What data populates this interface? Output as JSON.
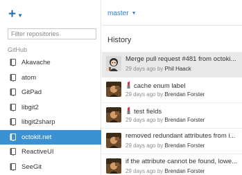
{
  "sidebar": {
    "add_icon": "plus-icon",
    "filter_placeholder": "Filter repositories",
    "group_label": "GitHub",
    "repos": [
      {
        "name": "Akavache",
        "selected": false
      },
      {
        "name": "atom",
        "selected": false
      },
      {
        "name": "GitPad",
        "selected": false
      },
      {
        "name": "libgit2",
        "selected": false
      },
      {
        "name": "libgit2sharp",
        "selected": false
      },
      {
        "name": "octokit.net",
        "selected": true
      },
      {
        "name": "ReactiveUI",
        "selected": false
      },
      {
        "name": "SeeGit",
        "selected": false
      }
    ]
  },
  "main": {
    "branch": "master",
    "history_title": "History",
    "commits": [
      {
        "title": "Merge pull request #481 from octoki...",
        "time": "29 days ago by",
        "author": "Phil Haack",
        "selected": true,
        "emoji": ""
      },
      {
        "title": "cache enum label",
        "time": "29 days ago by",
        "author": "Brendan Forster",
        "selected": false,
        "emoji": "lipstick-icon"
      },
      {
        "title": "test fields",
        "time": "29 days ago by",
        "author": "Brendan Forster",
        "selected": false,
        "emoji": "lipstick-icon"
      },
      {
        "title": "removed redundant attributes from i...",
        "time": "29 days ago by",
        "author": "Brendan Forster",
        "selected": false,
        "emoji": ""
      },
      {
        "title": "if the attribute cannot be found, lowe...",
        "time": "29 days ago by",
        "author": "Brendan Forster",
        "selected": false,
        "emoji": ""
      }
    ]
  },
  "colors": {
    "accent": "#3b91d2",
    "link": "#2f7ec6",
    "selected_commit_bg": "#e9e9e9"
  }
}
